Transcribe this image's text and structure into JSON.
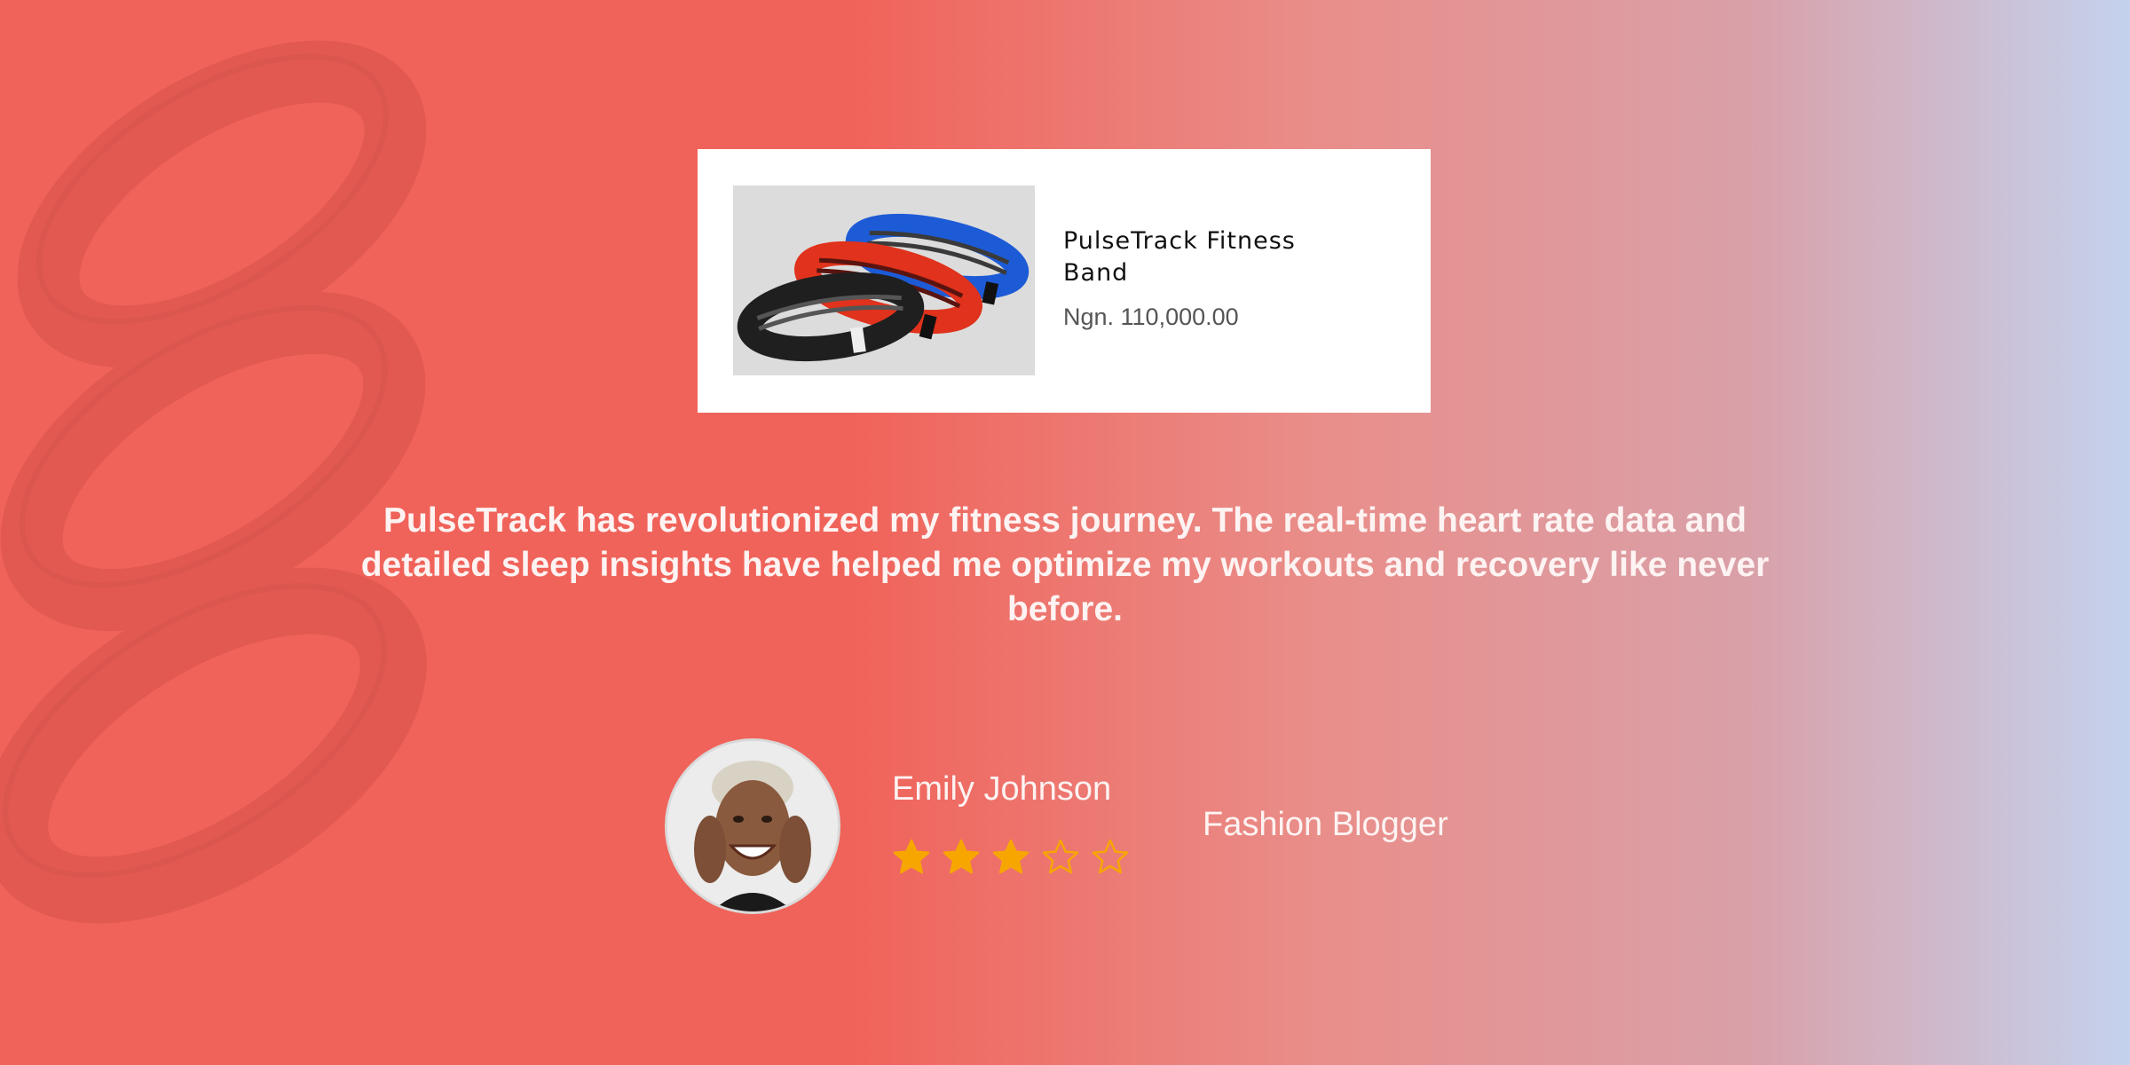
{
  "product": {
    "name": "PulseTrack Fitness Band",
    "price": "Ngn. 110,000.00",
    "image_icon": "resistance-bands-image",
    "band_colors": [
      "#1f1f1f",
      "#e0321c",
      "#1d5bd6"
    ]
  },
  "testimonial": {
    "quote": "PulseTrack has revolutionized my fitness journey. The real-time heart rate data and detailed sleep insights have helped me optimize my workouts and recovery like never before.",
    "reviewer": {
      "name": "Emily Johnson",
      "role": "Fashion Blogger",
      "avatar_icon": "reviewer-avatar"
    },
    "rating": {
      "value": 3,
      "max": 5,
      "filled_icon": "star-filled-icon",
      "empty_icon": "star-outline-icon",
      "color": "#f7a600"
    }
  },
  "colors": {
    "accent": "#f0635a",
    "card": "#ffffff",
    "text_light": "#fdf3f2"
  }
}
